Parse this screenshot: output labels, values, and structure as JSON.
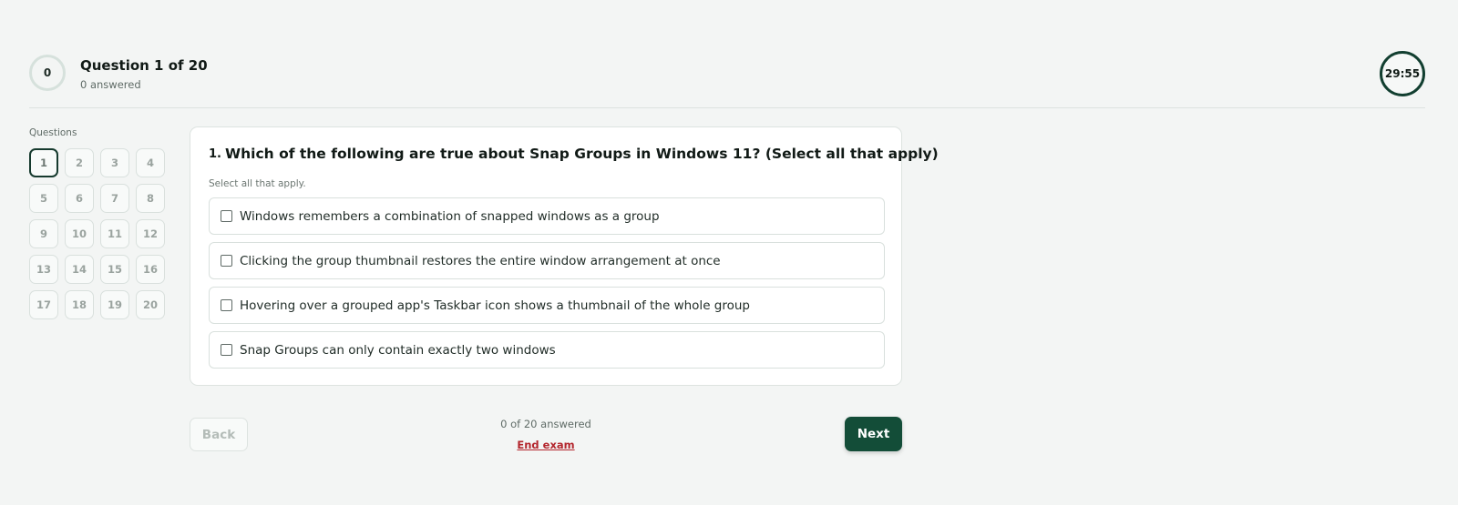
{
  "header": {
    "progress_count": "0",
    "question_title": "Question 1 of 20",
    "answered_label": "0 answered",
    "timer": "29:55"
  },
  "navigator": {
    "title": "Questions",
    "active_index": 0,
    "numbers": [
      "1",
      "2",
      "3",
      "4",
      "5",
      "6",
      "7",
      "8",
      "9",
      "10",
      "11",
      "12",
      "13",
      "14",
      "15",
      "16",
      "17",
      "18",
      "19",
      "20"
    ]
  },
  "question": {
    "number": "1.",
    "text": "Which of the following are true about Snap Groups in Windows 11? (Select all that apply)",
    "hint": "Select all that apply.",
    "options": [
      {
        "label": "Windows remembers a combination of snapped windows as a group",
        "checked": false
      },
      {
        "label": "Clicking the group thumbnail restores the entire window arrangement at once",
        "checked": false
      },
      {
        "label": "Hovering over a grouped app's Taskbar icon shows a thumbnail of the whole group",
        "checked": false
      },
      {
        "label": "Snap Groups can only contain exactly two windows",
        "checked": false
      }
    ]
  },
  "footer": {
    "back_label": "Back",
    "answered_summary": "0 of 20 answered",
    "end_exam_label": "End exam",
    "next_label": "Next"
  },
  "colors": {
    "primary": "#134d38",
    "danger": "#b3262d",
    "background": "#f3f5f4"
  }
}
